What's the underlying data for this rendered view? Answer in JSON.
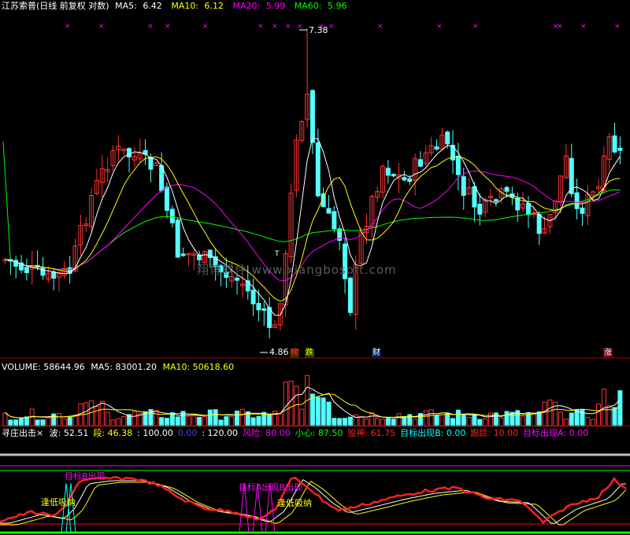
{
  "main": {
    "title": "江苏索普(日线 前复权 对数)",
    "ma5": {
      "label": "MA5:",
      "value": "6.42",
      "color": "#ffffff"
    },
    "ma10": {
      "label": "MA10:",
      "value": "6.12",
      "color": "#ffff00"
    },
    "ma20": {
      "label": "MA20:",
      "value": "5.99",
      "color": "#ff00ff"
    },
    "ma60": {
      "label": "MA60:",
      "value": "5.96",
      "color": "#00ff00"
    },
    "high_label": "7.38",
    "low_label": "4.86",
    "tags": [
      "榜",
      "跌",
      "财",
      "涨"
    ],
    "t_marker": "T"
  },
  "volume": {
    "label": "VOLUME: 58644.96",
    "ma5": "MA5: 83001.20",
    "ma10": "MA10: 50618.60"
  },
  "indicator": {
    "name": "寻庄出击",
    "close": "×",
    "items": [
      {
        "text": "波: 52.51",
        "color": "#ffffff"
      },
      {
        "text": "段: 46.38",
        "color": "#ffff00"
      },
      {
        "text": ": 100.00",
        "color": "#ffffff"
      },
      {
        "text": "0.00",
        "color": "#4040ff"
      },
      {
        "text": ": 120.00",
        "color": "#ffffff"
      },
      {
        "text": "风险: 80.00",
        "color": "#ff00ff"
      },
      {
        "text": "小心: 87.50",
        "color": "#00ff00"
      },
      {
        "text": "股神: 61.75",
        "color": "#ff2020"
      },
      {
        "text": "目标出现B: 0.00",
        "color": "#00ffff"
      },
      {
        "text": "跟踪: 10.00",
        "color": "#ff2020"
      },
      {
        "text": "目标出现A: 0.00",
        "color": "#ff00ff"
      }
    ],
    "annotations": {
      "target_b": "目标B出现",
      "low_buy": "逢低吸纳",
      "overlap": "目标A出现B出现",
      "low_buy2": "逢低吸纳"
    }
  },
  "watermark": "翔博软件  www.xiangbosoft.com",
  "colors": {
    "up": "#ff3232",
    "down": "#54ffff",
    "ma5": "#ffffff",
    "ma10": "#ffff00",
    "ma20": "#ff00ff",
    "ma60": "#00ff00"
  }
}
